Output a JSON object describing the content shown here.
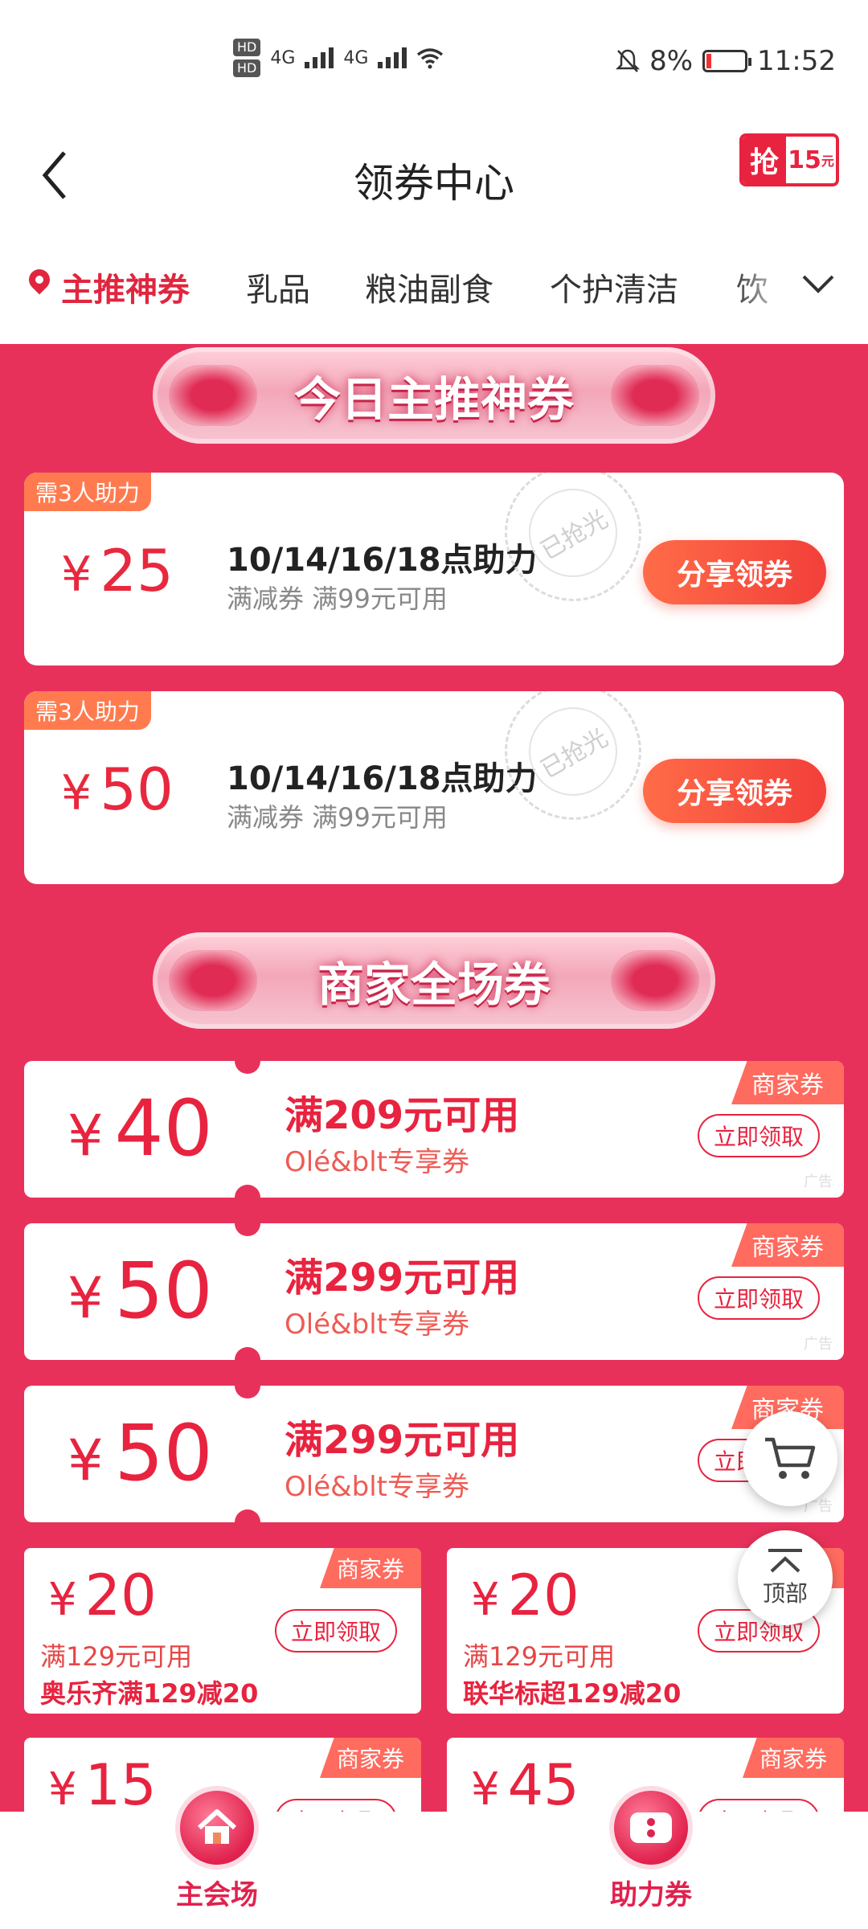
{
  "status_bar": {
    "time": "11:52",
    "battery": "8%",
    "sim1": "HD",
    "sim2": "HD",
    "net1": "4G",
    "net2": "4G"
  },
  "header": {
    "title": "领券中心",
    "back_icon": "chevron-left-icon",
    "promo_char": "抢",
    "promo_value": "15",
    "promo_unit": "元"
  },
  "tabs": [
    {
      "label": "主推神券",
      "active": true
    },
    {
      "label": "乳品",
      "active": false
    },
    {
      "label": "粮油副食",
      "active": false
    },
    {
      "label": "个护清洁",
      "active": false
    },
    {
      "label": "饮",
      "active": false
    }
  ],
  "sections": {
    "featured_title": "今日主推神券",
    "merchant_title": "商家全场券"
  },
  "help_coupons": [
    {
      "tag": "需3人助力",
      "currency": "¥",
      "amount": "25",
      "title": "10/14/16/18点助力",
      "subtitle": "满减券 满99元可用",
      "stamp": "已抢光",
      "button": "分享领券"
    },
    {
      "tag": "需3人助力",
      "currency": "¥",
      "amount": "50",
      "title": "10/14/16/18点助力",
      "subtitle": "满减券 满99元可用",
      "stamp": "已抢光",
      "button": "分享领券"
    }
  ],
  "merchant_coupons": [
    {
      "currency": "¥",
      "amount": "40",
      "condition": "满209元可用",
      "desc": "Olé&blt专享券",
      "tag": "商家券",
      "button": "立即领取",
      "ad": "广告"
    },
    {
      "currency": "¥",
      "amount": "50",
      "condition": "满299元可用",
      "desc": "Olé&blt专享券",
      "tag": "商家券",
      "button": "立即领取",
      "ad": "广告"
    },
    {
      "currency": "¥",
      "amount": "50",
      "condition": "满299元可用",
      "desc": "Olé&blt专享券",
      "tag": "商家券",
      "button": "立即领取",
      "ad": "广告"
    }
  ],
  "small_coupons": [
    {
      "currency": "¥",
      "amount": "20",
      "condition": "满129元可用",
      "name": "奥乐齐满129减20",
      "tag": "商家券",
      "button": "立即领取"
    },
    {
      "currency": "¥",
      "amount": "20",
      "condition": "满129元可用",
      "name": "联华标超129减20",
      "tag": "商家券",
      "button": "立即领取"
    },
    {
      "currency": "¥",
      "amount": "15",
      "condition": "",
      "name": "",
      "tag": "商家券",
      "button": "立即领取"
    },
    {
      "currency": "¥",
      "amount": "45",
      "condition": "",
      "name": "",
      "tag": "商家券",
      "button": "立即领取"
    }
  ],
  "floating": {
    "cart_icon": "cart-icon",
    "top_label": "顶部"
  },
  "bottom_nav": [
    {
      "label": "主会场",
      "icon": "home-icon"
    },
    {
      "label": "助力券",
      "icon": "coupon-icon"
    }
  ],
  "colors": {
    "primary": "#e8233f",
    "page_bg": "#e8315a",
    "tag_orange": "#ff6b5e"
  }
}
